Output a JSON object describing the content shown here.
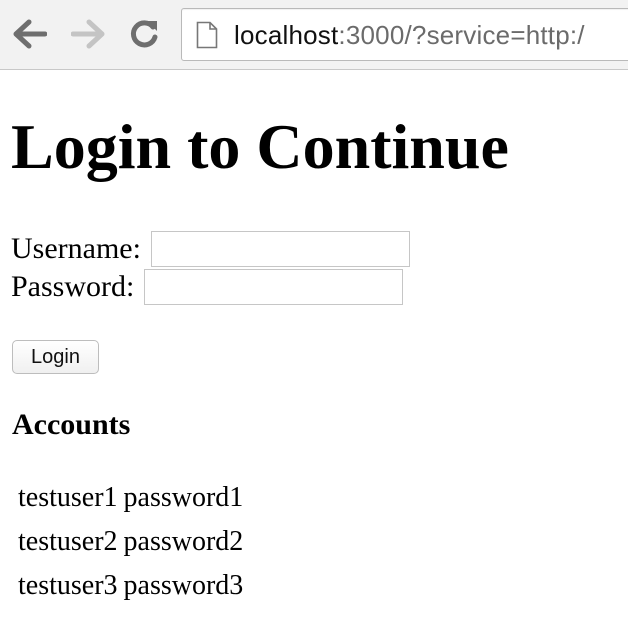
{
  "browser": {
    "url_host": "localhost",
    "url_rest": ":3000/?service=http:/",
    "icons": {
      "back": "arrow-left-icon",
      "forward": "arrow-right-icon",
      "reload": "reload-icon",
      "page": "page-icon"
    }
  },
  "page": {
    "title": "Login to Continue",
    "form": {
      "username_label": "Username:",
      "username_value": "",
      "password_label": "Password:",
      "password_value": "",
      "login_button": "Login"
    },
    "accounts": {
      "heading": "Accounts",
      "rows": [
        {
          "username": "testuser1",
          "password": "password1"
        },
        {
          "username": "testuser2",
          "password": "password2"
        },
        {
          "username": "testuser3",
          "password": "password3"
        }
      ]
    }
  },
  "colors": {
    "toolbar_bg": "#f2f2f2",
    "url_host": "#111111",
    "url_rest": "#6b6b6b",
    "icon_active": "#6e6e6e",
    "icon_disabled": "#c4c4c4"
  }
}
